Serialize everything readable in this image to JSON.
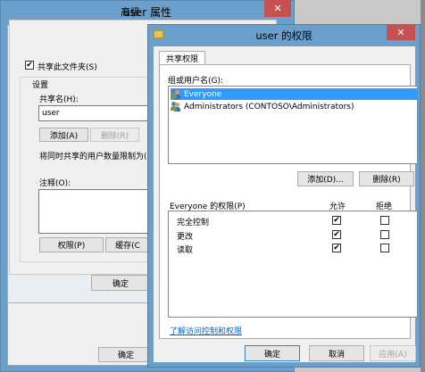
{
  "back_dialog": {
    "title": "user 属性",
    "close": "✕",
    "ok": "确定"
  },
  "inner_dialog": {
    "title": "高级",
    "share_checkbox": {
      "label": "共享此文件夹(S)",
      "checked": true
    },
    "settings_group": "设置",
    "share_name_label": "共享名(H):",
    "share_name_value": "user",
    "add": "添加(A)",
    "remove": "删除(R)",
    "limit_label": "将同时共享的用户数量限制为(L",
    "comment_label": "注释(O):",
    "permissions": "权限(P)",
    "cache": "缓存(C",
    "ok": "确定"
  },
  "front_dialog": {
    "title": "user 的权限",
    "close": "✕",
    "tab": "共享权限",
    "group_label": "组或用户名(G):",
    "users": [
      {
        "name": "Everyone",
        "selected": true
      },
      {
        "name": "Administrators (CONTOSO\\Administrators)",
        "selected": false
      }
    ],
    "add": "添加(D)...",
    "remove": "删除(R)",
    "perm_header": "Everyone 的权限(P)",
    "allow": "允许",
    "deny": "拒绝",
    "permissions": [
      {
        "name": "完全控制",
        "allow": true,
        "deny": false
      },
      {
        "name": "更改",
        "allow": true,
        "deny": false
      },
      {
        "name": "读取",
        "allow": true,
        "deny": false
      }
    ],
    "help_link": "了解访问控制和权限",
    "ok": "确定",
    "cancel": "取消",
    "apply": "应用(A)"
  }
}
